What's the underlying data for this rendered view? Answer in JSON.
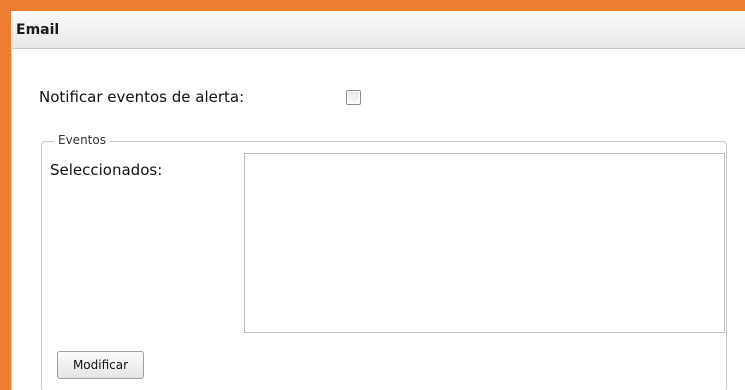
{
  "panel": {
    "title": "Email"
  },
  "alerts": {
    "notify_label": "Notificar eventos de alerta:",
    "notify_checked": false
  },
  "events": {
    "legend": "Eventos",
    "selected_label": "Seleccionados:",
    "selected_items": [],
    "modify_label": "Modificar"
  },
  "colors": {
    "frame": "#ed7d31",
    "panel_bg": "#f3f3f3",
    "content_bg": "#ffffff",
    "border": "#c7c7c7"
  }
}
